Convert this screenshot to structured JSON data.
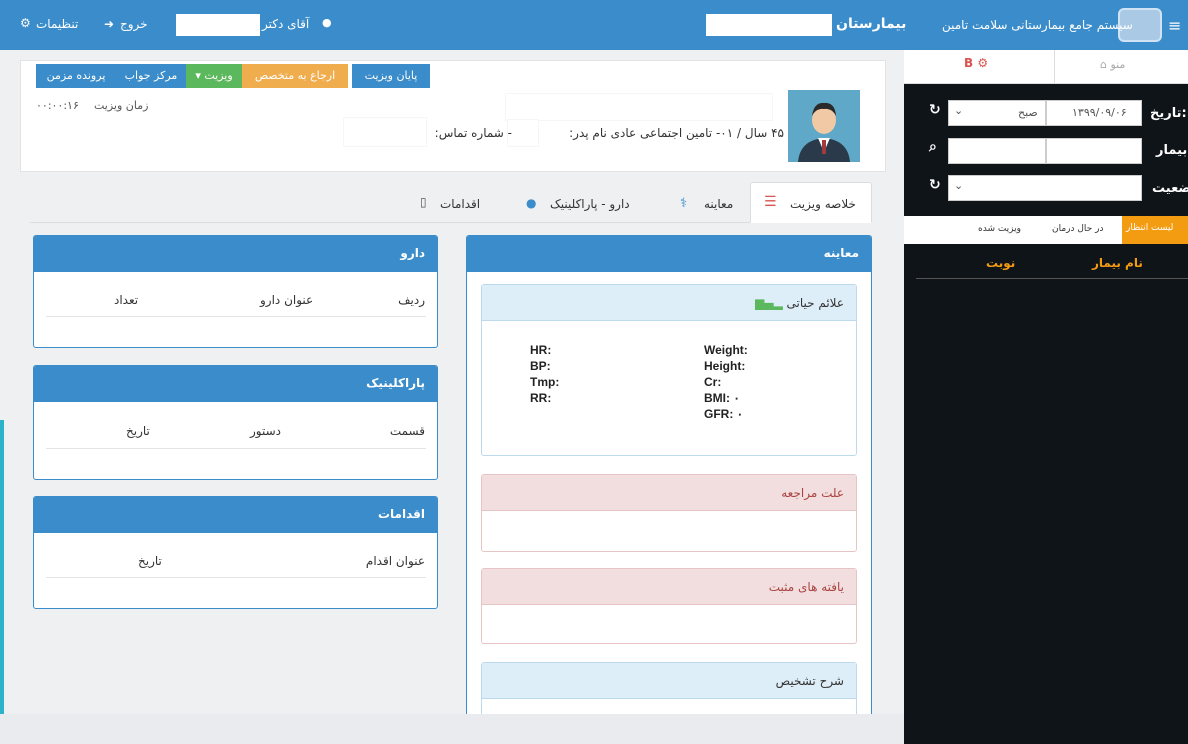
{
  "topbar": {
    "menu_icon": "hamburger-icon",
    "system_title": "سیستم جامع بیمارستانی سلامت تامین",
    "hospital_label": "بیمارستان",
    "doctor_label": "آقای دکتر",
    "logout_label": "خروج",
    "settings_label": "تنظیمات"
  },
  "sidebar": {
    "menu_tab": "منو",
    "b_tab": "B",
    "date_label": "تاریخ:",
    "date_value": "۱۳۹۹/۰۹/۰۶",
    "shift_value": "صبح",
    "patient_label": "بیمار:",
    "status_label": "ضعیت:",
    "tabs": [
      "لیست انتظار",
      "در حال درمان",
      "ویزیت شده"
    ],
    "columns": [
      "نام بیمار",
      "نوبت"
    ]
  },
  "toolbar": {
    "end_visit": "پایان ویزیت",
    "refer_specialist": "ارجاع به متخصص",
    "visit": "ویزیت",
    "result_center": "مرکز جواب",
    "chronic_file": "پرونده مزمن"
  },
  "patient": {
    "info": "۴۵ سال / ۰۱- تامین اجتماعی عادی  نام پدر:",
    "contact_label": "- شماره تماس:",
    "visit_time_label": "زمان ویزیت",
    "visit_time_value": "۰۰:۰۰:۱۶"
  },
  "tabs": [
    "خلاصه ویزیت",
    "معاینه",
    "دارو - پاراکلینیک",
    "اقدامات"
  ],
  "exam": {
    "title": "معاینه",
    "vitals_title": "علائم حیاتی",
    "vitals_left": [
      "HR:",
      "BP:",
      "Tmp:",
      "RR:"
    ],
    "vitals_right": [
      "Weight:",
      "Height:",
      "Cr:",
      "BMI: ۰",
      "GFR: ۰"
    ],
    "reason_title": "علت مراجعه",
    "findings_title": "یافته های مثبت",
    "diagnosis_title": "شرح تشخیص"
  },
  "drug": {
    "title": "دارو",
    "columns": [
      "ردیف",
      "عنوان دارو",
      "تعداد"
    ]
  },
  "paraclinic": {
    "title": "پاراکلینیک",
    "columns": [
      "قسمت",
      "دستور",
      "تاریخ"
    ]
  },
  "actions": {
    "title": "اقدامات",
    "columns": [
      "عنوان اقدام",
      "تاریخ"
    ]
  },
  "colors": {
    "primary": "#3a8cca",
    "orange": "#f0ad4e",
    "green": "#5cb85c",
    "dark": "#0f1419",
    "accent": "#f39c12"
  }
}
